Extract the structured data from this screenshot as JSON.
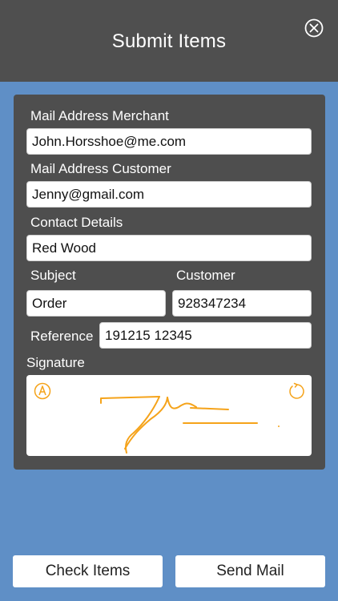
{
  "header": {
    "title": "Submit Items",
    "close_icon": "circle-x-icon"
  },
  "form": {
    "merchant_label": "Mail Address Merchant",
    "merchant_value": "John.Horsshoe@me.com",
    "customer_mail_label": "Mail Address Customer",
    "customer_mail_value": "Jenny@gmail.com",
    "contact_label": "Contact Details",
    "contact_value": "Red Wood",
    "subject_label": "Subject",
    "subject_value": "Order",
    "customer_label": "Customer",
    "customer_value": "928347234",
    "reference_label": "Reference",
    "reference_value": "191215 12345",
    "signature_label": "Signature",
    "signature_color": "#f5a31a",
    "pen_icon": "pen-circle-icon",
    "reset_icon": "refresh-icon"
  },
  "buttons": {
    "check_items": "Check Items",
    "send_mail": "Send Mail"
  },
  "colors": {
    "background": "#5f8fc6",
    "header": "#4f4f4f",
    "panel": "#4e4e4e"
  }
}
